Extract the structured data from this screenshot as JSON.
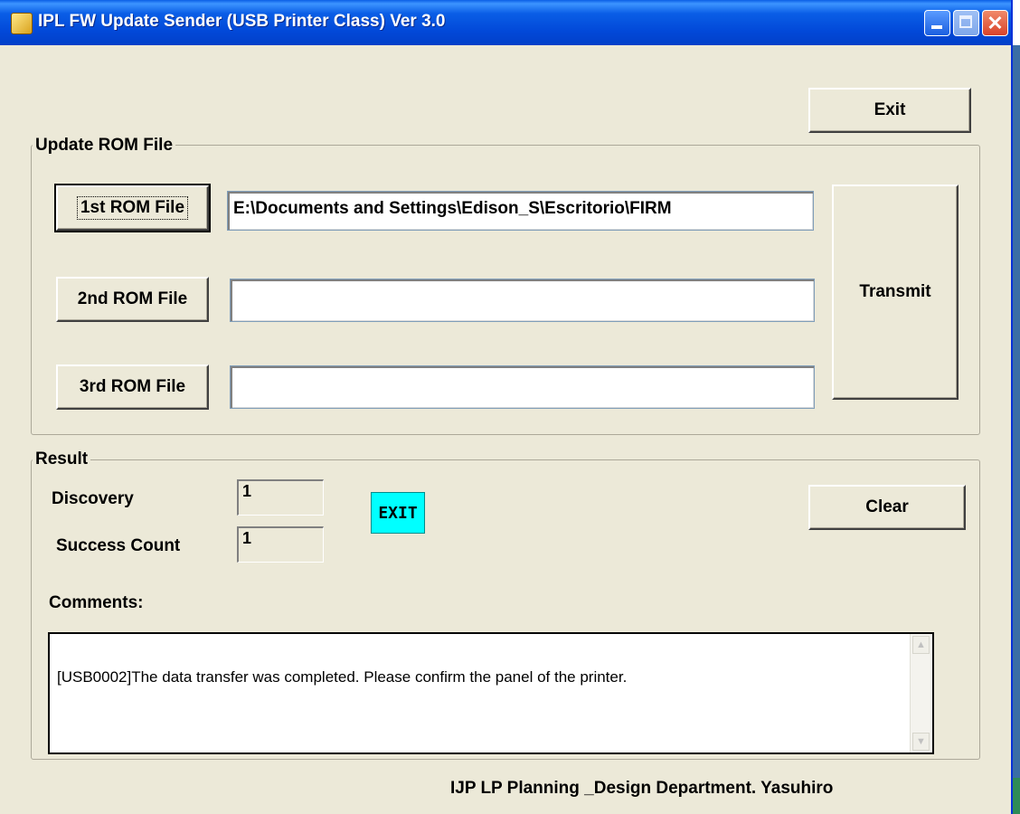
{
  "window": {
    "title": "IPL FW Update Sender (USB Printer Class)  Ver 3.0"
  },
  "toolbar": {
    "exit_label": "Exit"
  },
  "update_group": {
    "legend": "Update ROM File",
    "rom1": {
      "button": "1st ROM File",
      "path": "E:\\Documents and Settings\\Edison_S\\Escritorio\\FIRM"
    },
    "rom2": {
      "button": "2nd ROM File",
      "path": ""
    },
    "rom3": {
      "button": "3rd ROM File",
      "path": ""
    },
    "transmit_label": "Transmit"
  },
  "result_group": {
    "legend": "Result",
    "discovery_label": "Discovery",
    "discovery_value": "1",
    "success_label": "Success Count",
    "success_value": "1",
    "status_badge": "EXIT",
    "status_color": "#00ffff",
    "clear_label": "Clear",
    "comments_label": "Comments:",
    "comments_text": "[USB0002]The data transfer was completed. Please confirm the panel of the printer."
  },
  "footer": {
    "credit": "IJP LP Planning _Design Department.  Yasuhiro"
  },
  "icons": [
    "app-icon",
    "minimize-icon",
    "maximize-icon",
    "close-icon",
    "scroll-up-icon",
    "scroll-down-icon"
  ]
}
